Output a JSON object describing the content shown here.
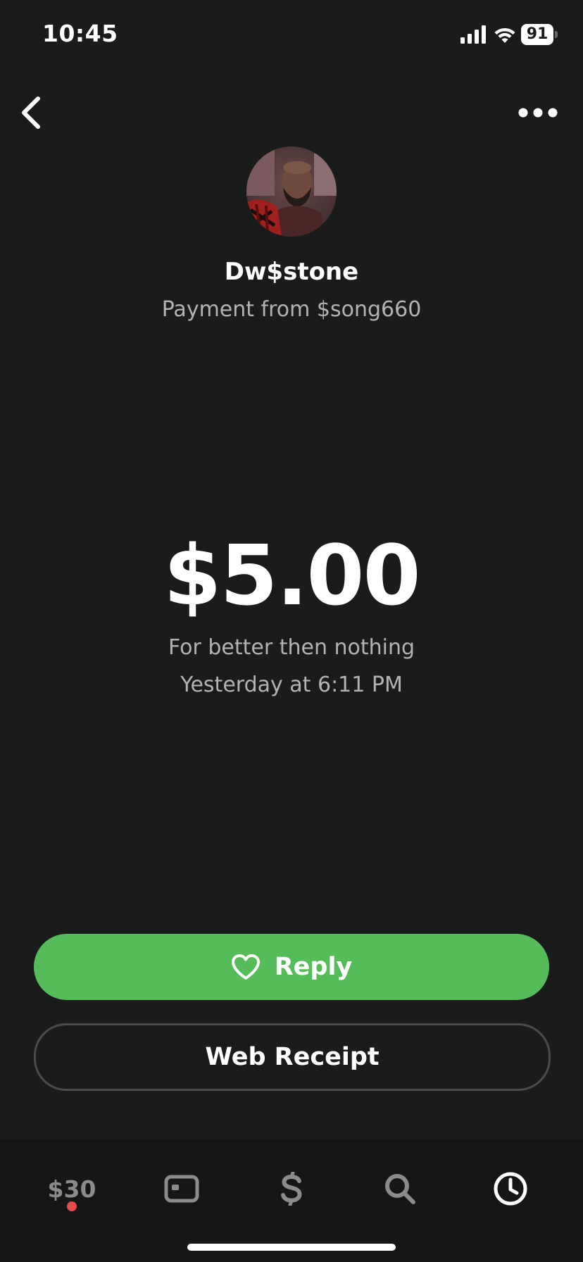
{
  "status_bar": {
    "time": "10:45",
    "battery_level": "91"
  },
  "header": {
    "back_icon": "chevron-left-icon",
    "more_icon": "ellipsis-icon"
  },
  "profile": {
    "display_name": "Dw$stone",
    "subtitle": "Payment from $song660"
  },
  "payment": {
    "amount": "$5.00",
    "note": "For better then nothing",
    "timestamp": "Yesterday at 6:11 PM"
  },
  "actions": {
    "reply_label": "Reply",
    "receipt_label": "Web Receipt"
  },
  "tab_bar": {
    "balance_label": "$30",
    "tabs": [
      "balance",
      "card-icon",
      "dollar-icon",
      "search-icon",
      "clock-icon"
    ],
    "active_tab": "clock-icon",
    "notification_color": "#e54b4b"
  },
  "colors": {
    "background": "#1a1b1b",
    "accent_green": "#56bc5a",
    "muted_text": "#b3b3b3"
  }
}
